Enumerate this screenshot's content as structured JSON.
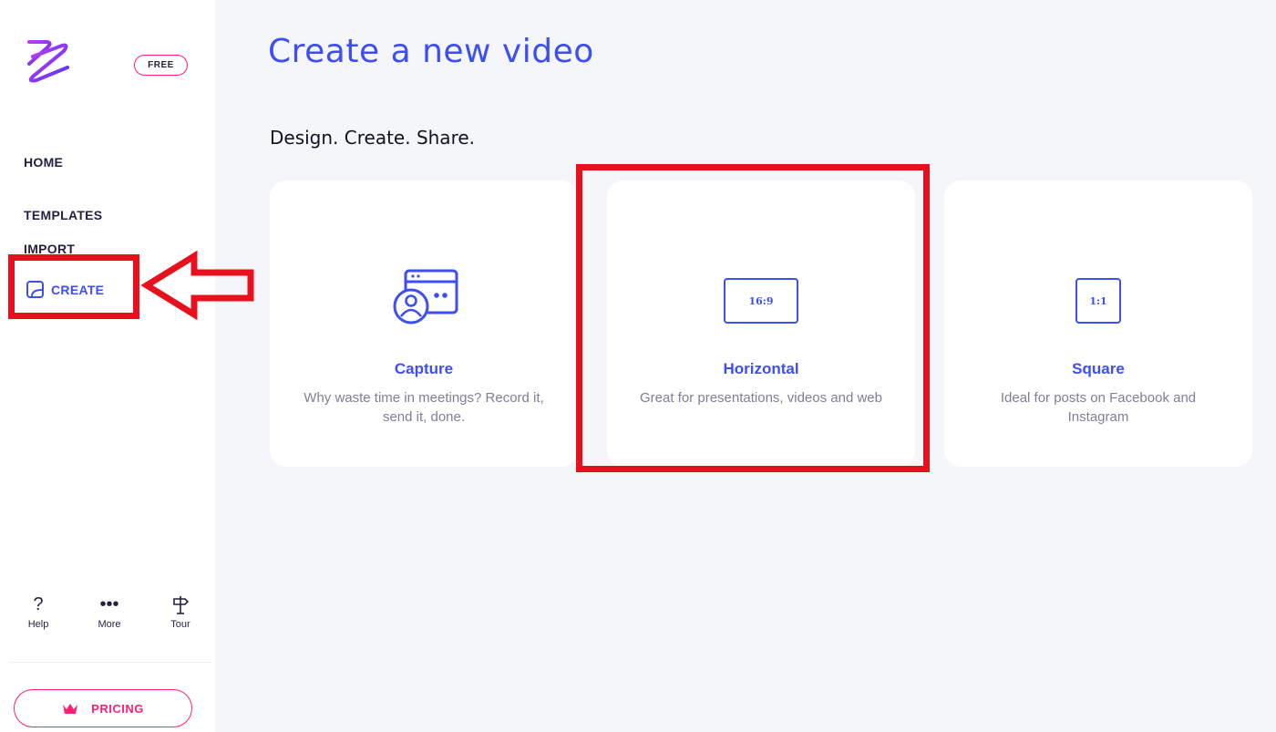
{
  "brand": {
    "badge": "FREE"
  },
  "sidebar": {
    "items": [
      {
        "label": "HOME"
      },
      {
        "label": "TEMPLATES"
      },
      {
        "label": "IMPORT"
      },
      {
        "label": "CREATE"
      }
    ],
    "tools": [
      {
        "icon": "help-icon",
        "label": "Help"
      },
      {
        "icon": "more-icon",
        "label": "More"
      },
      {
        "icon": "signpost-icon",
        "label": "Tour"
      }
    ],
    "pricing_label": "PRICING"
  },
  "main": {
    "title": "Create a new video",
    "subtitle": "Design. Create. Share.",
    "cards": [
      {
        "title": "Capture",
        "desc": "Why waste time in meetings? Record it, send it, done.",
        "icon": "capture-icon"
      },
      {
        "title": "Horizontal",
        "desc": "Great for presentations, videos and web",
        "ratio": "16:9"
      },
      {
        "title": "Square",
        "desc": "Ideal for posts on Facebook and Instagram",
        "ratio": "1:1"
      }
    ]
  },
  "colors": {
    "accent": "#3d4ef7",
    "brand_pink": "#ff1f73",
    "annotation_red": "#e8101d",
    "background": "#f5f6fa"
  }
}
